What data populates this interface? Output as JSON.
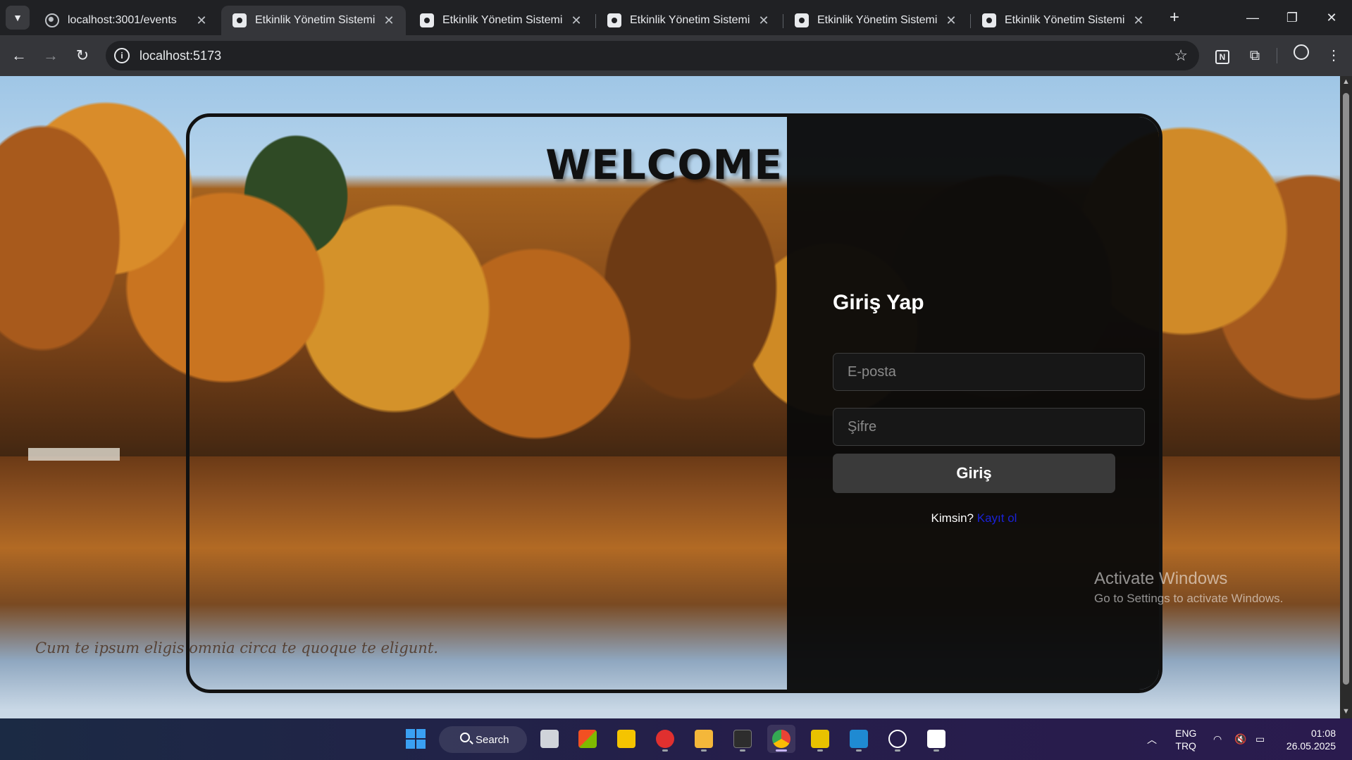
{
  "browser": {
    "tabs": [
      {
        "title": "localhost:3001/events",
        "icon": "globe-icon",
        "active": false
      },
      {
        "title": "Etkinlik Yönetim Sistemi",
        "icon": "app-icon",
        "active": true
      },
      {
        "title": "Etkinlik Yönetim Sistemi",
        "icon": "app-icon",
        "active": false
      },
      {
        "title": "Etkinlik Yönetim Sistemi",
        "icon": "app-icon",
        "active": false
      },
      {
        "title": "Etkinlik Yönetim Sistemi",
        "icon": "app-icon",
        "active": false
      },
      {
        "title": "Etkinlik Yönetim Sistemi",
        "icon": "app-icon",
        "active": false
      }
    ],
    "url": "localhost:5173"
  },
  "page": {
    "welcome": "WELCOME",
    "login_title": "Giriş Yap",
    "email_placeholder": "E-posta",
    "password_placeholder": "Şifre",
    "login_button": "Giriş",
    "signup_prompt": "Kimsin?",
    "signup_link": "Kayıt ol",
    "quote": "Cum te ipsum eligis omnia circa te quoque te eligunt."
  },
  "watermark": {
    "line1": "Activate Windows",
    "line2": "Go to Settings to activate Windows."
  },
  "taskbar": {
    "search_label": "Search",
    "lang_top": "ENG",
    "lang_bottom": "TRQ",
    "time": "01:08",
    "date": "26.05.2025"
  },
  "colors": {
    "link": "#1a22d6",
    "panel": "#0a0a0a",
    "button": "#3a3a3a"
  }
}
